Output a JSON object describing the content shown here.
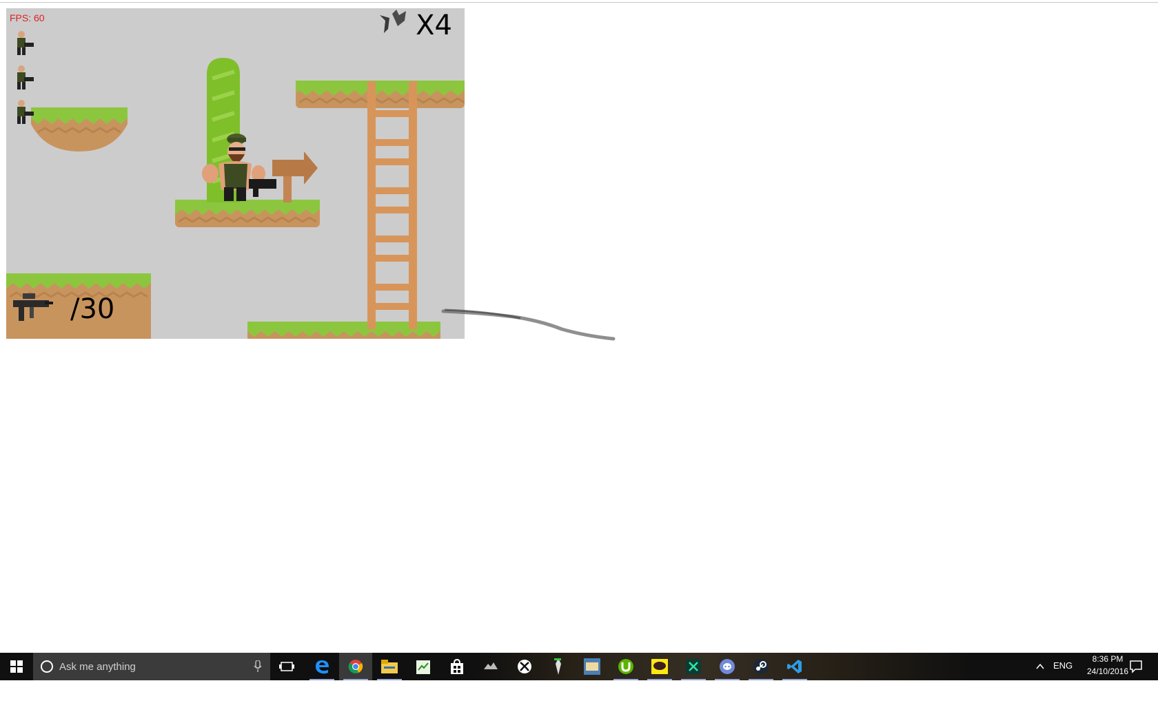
{
  "game": {
    "fps_label": "FPS: 60",
    "enemy_multiplier": "X4",
    "ammo_label": "/30",
    "lives": 3,
    "colors": {
      "background": "#cccccc",
      "grass": "#8cc63f",
      "dirt": "#c8945e",
      "wood": "#d8955a"
    }
  },
  "taskbar": {
    "search_placeholder": "Ask me anything",
    "language": "ENG",
    "time": "8:36 PM",
    "date": "24/10/2016",
    "apps": [
      "task-view-icon",
      "edge-icon",
      "chrome-icon",
      "file-explorer-icon",
      "notepad-icon",
      "store-icon",
      "game-icon",
      "xbox-icon",
      "app-icon",
      "mail-icon",
      "utorrent-icon",
      "kakaotalk-icon",
      "excel-like-icon",
      "discord-icon",
      "steam-icon",
      "vscode-icon"
    ]
  }
}
